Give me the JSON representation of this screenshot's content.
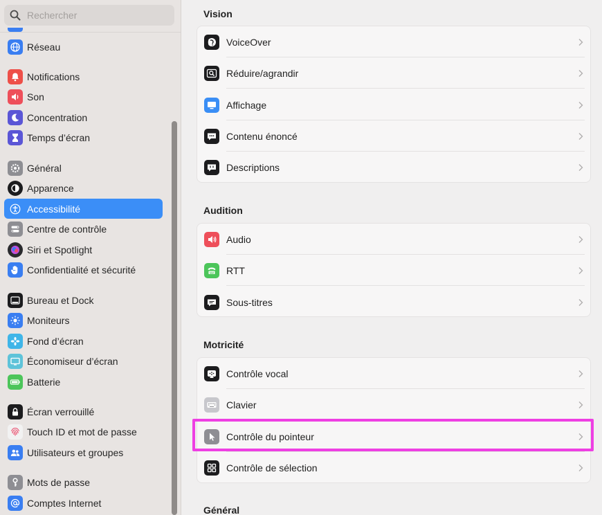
{
  "search": {
    "placeholder": "Rechercher"
  },
  "sidebar": {
    "items": [
      {
        "label": "Réseau",
        "icon": "globe-icon",
        "color": "#3a7ef1"
      },
      {
        "label": "Notifications",
        "icon": "bell-icon",
        "color": "#ee4f48"
      },
      {
        "label": "Son",
        "icon": "speaker-icon",
        "color": "#ee4f5a"
      },
      {
        "label": "Concentration",
        "icon": "moon-icon",
        "color": "#5b56d6"
      },
      {
        "label": "Temps d’écran",
        "icon": "hourglass-icon",
        "color": "#5b56d6"
      },
      {
        "label": "Général",
        "icon": "gear-icon",
        "color": "#8e8e93"
      },
      {
        "label": "Apparence",
        "icon": "appearance-icon",
        "color": "#1c1c1e"
      },
      {
        "label": "Accessibilité",
        "icon": "accessibility-icon",
        "color": "#3a7ef1",
        "selected": true
      },
      {
        "label": "Centre de contrôle",
        "icon": "control-center-icon",
        "color": "#8e8e93"
      },
      {
        "label": "Siri et Spotlight",
        "icon": "siri-icon",
        "color": "#2a2a2e"
      },
      {
        "label": "Confidentialité et sécurité",
        "icon": "hand-icon",
        "color": "#3a7ef1"
      },
      {
        "label": "Bureau et Dock",
        "icon": "dock-icon",
        "color": "#1c1c1e"
      },
      {
        "label": "Moniteurs",
        "icon": "sun-icon",
        "color": "#3a7ef1"
      },
      {
        "label": "Fond d’écran",
        "icon": "wallpaper-icon",
        "color": "#3fb5e8"
      },
      {
        "label": "Économiseur d’écran",
        "icon": "screensaver-icon",
        "color": "#5ec3d9"
      },
      {
        "label": "Batterie",
        "icon": "battery-icon",
        "color": "#4cc55a"
      },
      {
        "label": "Écran verrouillé",
        "icon": "lock-icon",
        "color": "#1c1c1e"
      },
      {
        "label": "Touch ID et mot de passe",
        "icon": "fingerprint-icon",
        "color": "#f2f2f2"
      },
      {
        "label": "Utilisateurs et groupes",
        "icon": "users-icon",
        "color": "#3a7ef1"
      },
      {
        "label": "Mots de passe",
        "icon": "key-icon",
        "color": "#8e8e93"
      },
      {
        "label": "Comptes Internet",
        "icon": "at-icon",
        "color": "#3a7ef1"
      }
    ]
  },
  "main": {
    "sections": [
      {
        "title": "Vision",
        "rows": [
          {
            "label": "VoiceOver",
            "icon": "voiceover-icon",
            "color": "#1c1c1e"
          },
          {
            "label": "Réduire/agrandir",
            "icon": "zoom-icon",
            "color": "#1c1c1e"
          },
          {
            "label": "Affichage",
            "icon": "display-icon",
            "color": "#3a8ef5"
          },
          {
            "label": "Contenu énoncé",
            "icon": "spoken-content-icon",
            "color": "#1c1c1e"
          },
          {
            "label": "Descriptions",
            "icon": "descriptions-icon",
            "color": "#1c1c1e"
          }
        ]
      },
      {
        "title": "Audition",
        "rows": [
          {
            "label": "Audio",
            "icon": "audio-icon",
            "color": "#ee4f5a"
          },
          {
            "label": "RTT",
            "icon": "rtt-icon",
            "color": "#4cc55a"
          },
          {
            "label": "Sous-titres",
            "icon": "subtitles-icon",
            "color": "#1c1c1e"
          }
        ]
      },
      {
        "title": "Motricité",
        "rows": [
          {
            "label": "Contrôle vocal",
            "icon": "voice-control-icon",
            "color": "#1c1c1e"
          },
          {
            "label": "Clavier",
            "icon": "keyboard-icon",
            "color": "#c7c7cc"
          },
          {
            "label": "Contrôle du pointeur",
            "icon": "pointer-icon",
            "color": "#8e8e93"
          },
          {
            "label": "Contrôle de sélection",
            "icon": "switch-control-icon",
            "color": "#1c1c1e"
          }
        ]
      },
      {
        "title": "Général",
        "rows": []
      }
    ]
  },
  "highlight_color": "#ee3fe3"
}
